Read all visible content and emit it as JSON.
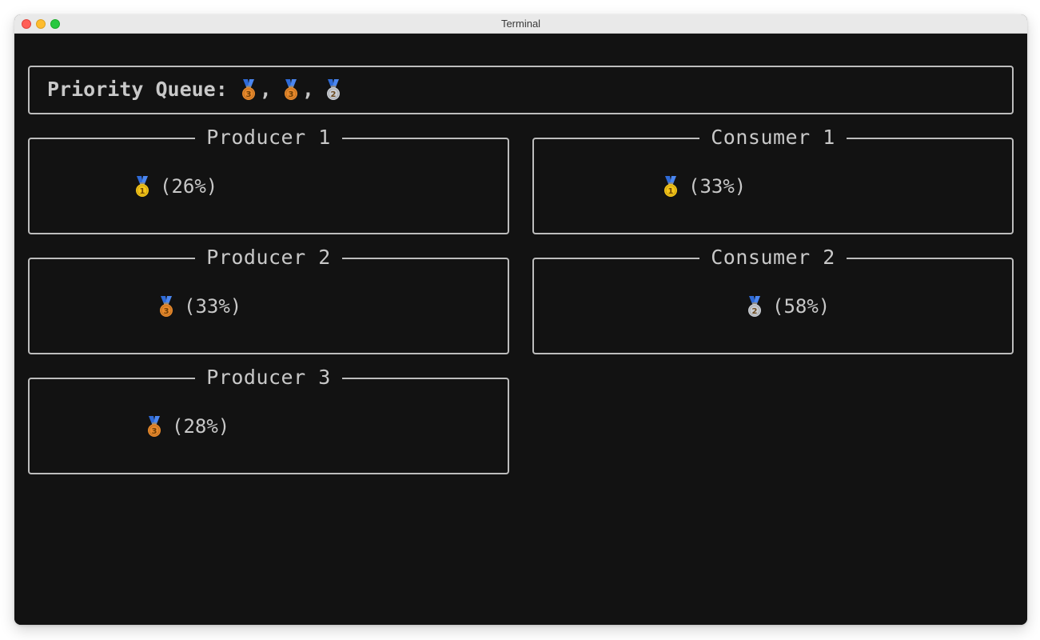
{
  "window": {
    "title": "Terminal"
  },
  "queue": {
    "label": "Priority Queue:",
    "items": [
      {
        "medal": "bronze",
        "rank": "3"
      },
      {
        "medal": "bronze",
        "rank": "3"
      },
      {
        "medal": "silver",
        "rank": "2"
      }
    ],
    "separator": ","
  },
  "producers": [
    {
      "title": "Producer 1",
      "medal": "gold",
      "rank": "1",
      "progress": "(26%)"
    },
    {
      "title": "Producer 2",
      "medal": "bronze",
      "rank": "3",
      "progress": "(33%)"
    },
    {
      "title": "Producer 3",
      "medal": "bronze",
      "rank": "3",
      "progress": "(28%)"
    }
  ],
  "consumers": [
    {
      "title": "Consumer 1",
      "medal": "gold",
      "rank": "1",
      "progress": "(33%)"
    },
    {
      "title": "Consumer 2",
      "medal": "silver",
      "rank": "2",
      "progress": "(58%)"
    }
  ],
  "colors": {
    "terminal_bg": "#121212",
    "text": "#c8c8c8",
    "border": "#bdbdbd",
    "gold": "#f5c518",
    "silver": "#c9ccd1",
    "bronze": "#e8892b",
    "ribbon": "#2f6bd8"
  }
}
